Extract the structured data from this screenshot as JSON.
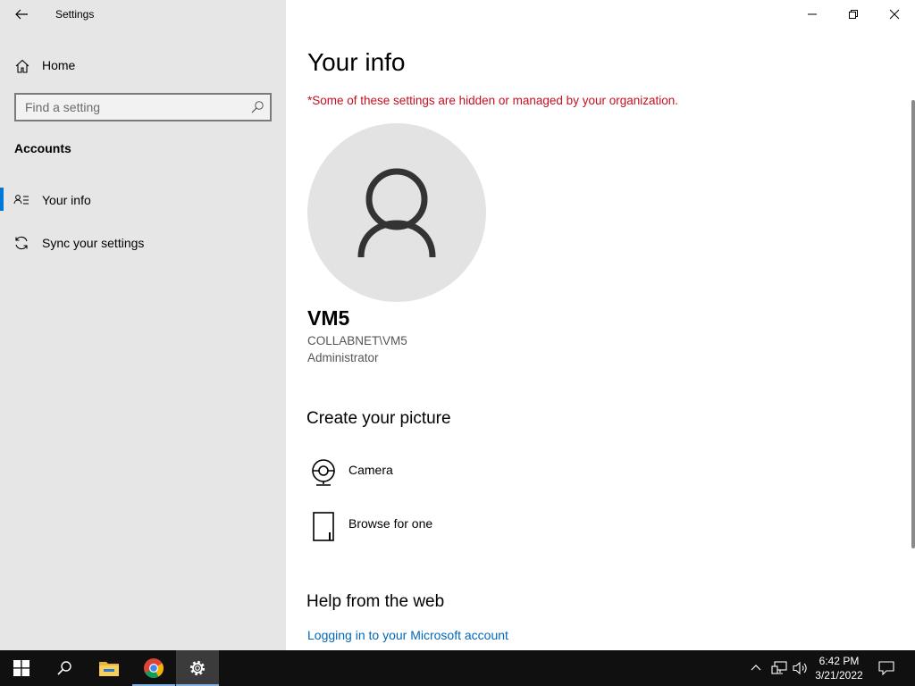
{
  "window": {
    "title": "Settings"
  },
  "sidebar": {
    "home_label": "Home",
    "search_placeholder": "Find a setting",
    "section_title": "Accounts",
    "items": [
      {
        "label": "Your info",
        "icon": "contact-info-icon",
        "active": true
      },
      {
        "label": "Sync your settings",
        "icon": "sync-icon",
        "active": false
      }
    ]
  },
  "main": {
    "title": "Your info",
    "warning": "*Some of these settings are hidden or managed by your organization.",
    "user": {
      "name": "VM5",
      "account": "COLLABNET\\VM5",
      "role": "Administrator"
    },
    "create_picture": {
      "heading": "Create your picture",
      "options": [
        {
          "label": "Camera",
          "icon": "camera-icon"
        },
        {
          "label": "Browse for one",
          "icon": "browse-file-icon"
        }
      ]
    },
    "help": {
      "heading": "Help from the web",
      "link": "Logging in to your Microsoft account"
    }
  },
  "taskbar": {
    "apps": [
      "start-icon",
      "search-icon",
      "file-explorer-icon",
      "chrome-icon",
      "settings-icon"
    ],
    "time": "6:42 PM",
    "date": "3/21/2022"
  },
  "colors": {
    "accent": "#0078d7",
    "warning": "#c50f1f",
    "link": "#0067b8",
    "sidebar_bg": "#e6e6e6",
    "taskbar_bg": "#101010"
  }
}
